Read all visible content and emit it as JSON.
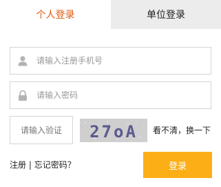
{
  "tabs": {
    "personal": "个人登录",
    "unit": "单位登录"
  },
  "form": {
    "phone_placeholder": "请输入注册手机号",
    "password_placeholder": "请输入密码",
    "captcha_placeholder": "请输入验证",
    "captcha_text": "27oA",
    "refresh_label": "看不清，换一下"
  },
  "links": {
    "register": "注册",
    "separator": " | ",
    "forgot": "忘记密码？"
  },
  "login_button": "登录",
  "colors": {
    "active_tab": "#e0560d",
    "button": "#fbae16",
    "captcha_bg": "#cfcfcf"
  }
}
